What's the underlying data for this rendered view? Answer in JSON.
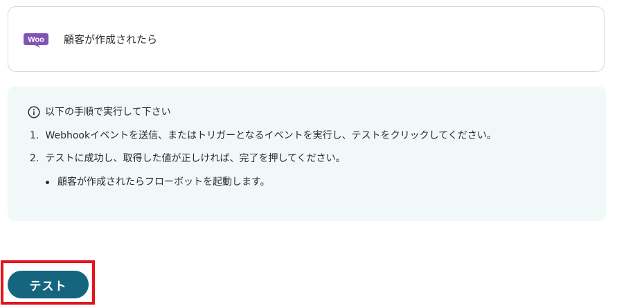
{
  "trigger": {
    "logo_text": "Woo",
    "title": "顧客が作成されたら"
  },
  "instructions": {
    "heading": "以下の手順で実行して下さい",
    "steps": [
      {
        "number": "1.",
        "text": "Webhookイベントを送信、またはトリガーとなるイベントを実行し、テストをクリックしてください。"
      },
      {
        "number": "2.",
        "text": "テストに成功し、取得した値が正しければ、完了を押してください。"
      }
    ],
    "bullets": [
      "顧客が作成されたらフローボットを起動します。"
    ]
  },
  "actions": {
    "test_label": "テスト"
  },
  "colors": {
    "woo_purple": "#7f54b3",
    "panel_background": "#f1f8f8",
    "button": "#16657f",
    "highlight": "#e4141b"
  }
}
